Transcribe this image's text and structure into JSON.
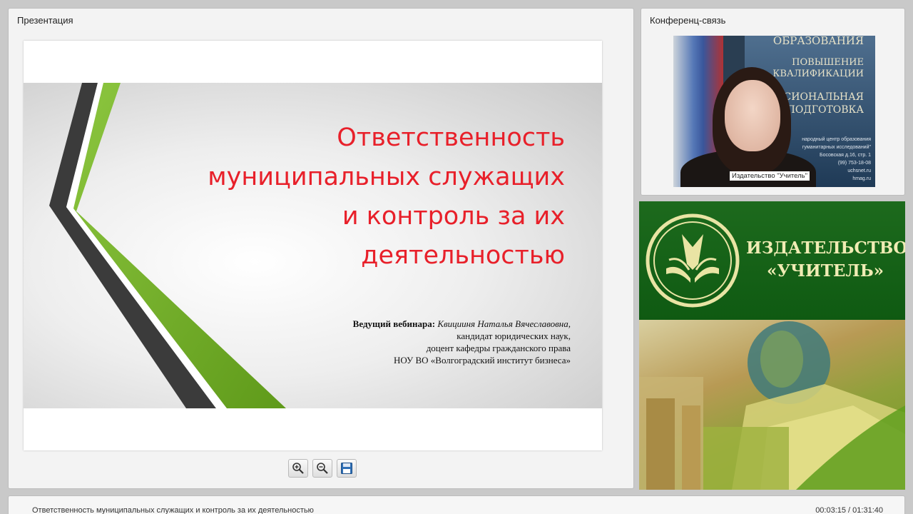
{
  "presentation_panel": {
    "title": "Презентация",
    "slide": {
      "title": "Ответственность\nмуниципальных служащих\nи контроль за их\nдеятельностью",
      "host_label": "Ведущий вебинара:",
      "host_name": "Квицииня Наталья Вячеславовна,",
      "host_degree": "кандидат юридических наук,",
      "host_position": "доцент кафедры гражданского права",
      "host_org": "НОУ ВО «Волгоградский институт бизнеса»"
    },
    "toolbar": [
      {
        "name": "zoom-in",
        "icon": "zoom-in-icon"
      },
      {
        "name": "zoom-out",
        "icon": "zoom-out-icon"
      },
      {
        "name": "save",
        "icon": "floppy-disk-icon"
      }
    ]
  },
  "conference_panel": {
    "title": "Конференц-связь",
    "video_label": "Издательство \"Учитель\"",
    "banner": {
      "line1": "ОБРАЗОВАНИЯ",
      "line2": "ПОВЫШЕНИЕ",
      "line3": "КВАЛИФИКАЦИИ",
      "line4": "СИОНАЛЬНАЯ",
      "line5": "ПОДГОТОВКА",
      "small": "народный центр образования\nгуманитарных исследований\"\nБосовская д.16, стр. 1\n(99) 753-18-08\nuchsnet.ru\nhmag.ru"
    }
  },
  "ad_panel": {
    "brand_line1": "ИЗДАТЕЛЬСТВО",
    "brand_line2": "«УЧИТЕЛЬ»",
    "logo_icon": "uchitel-logo-icon"
  },
  "bottom_bar": {
    "title": "Ответственность муниципальных служащих и контроль за их деятельностью",
    "time": "00:03:15 / 01:31:40"
  },
  "colors": {
    "slide_title": "#e8202a",
    "ad_green": "#0f5a12",
    "ad_text": "#f0ecb4"
  }
}
